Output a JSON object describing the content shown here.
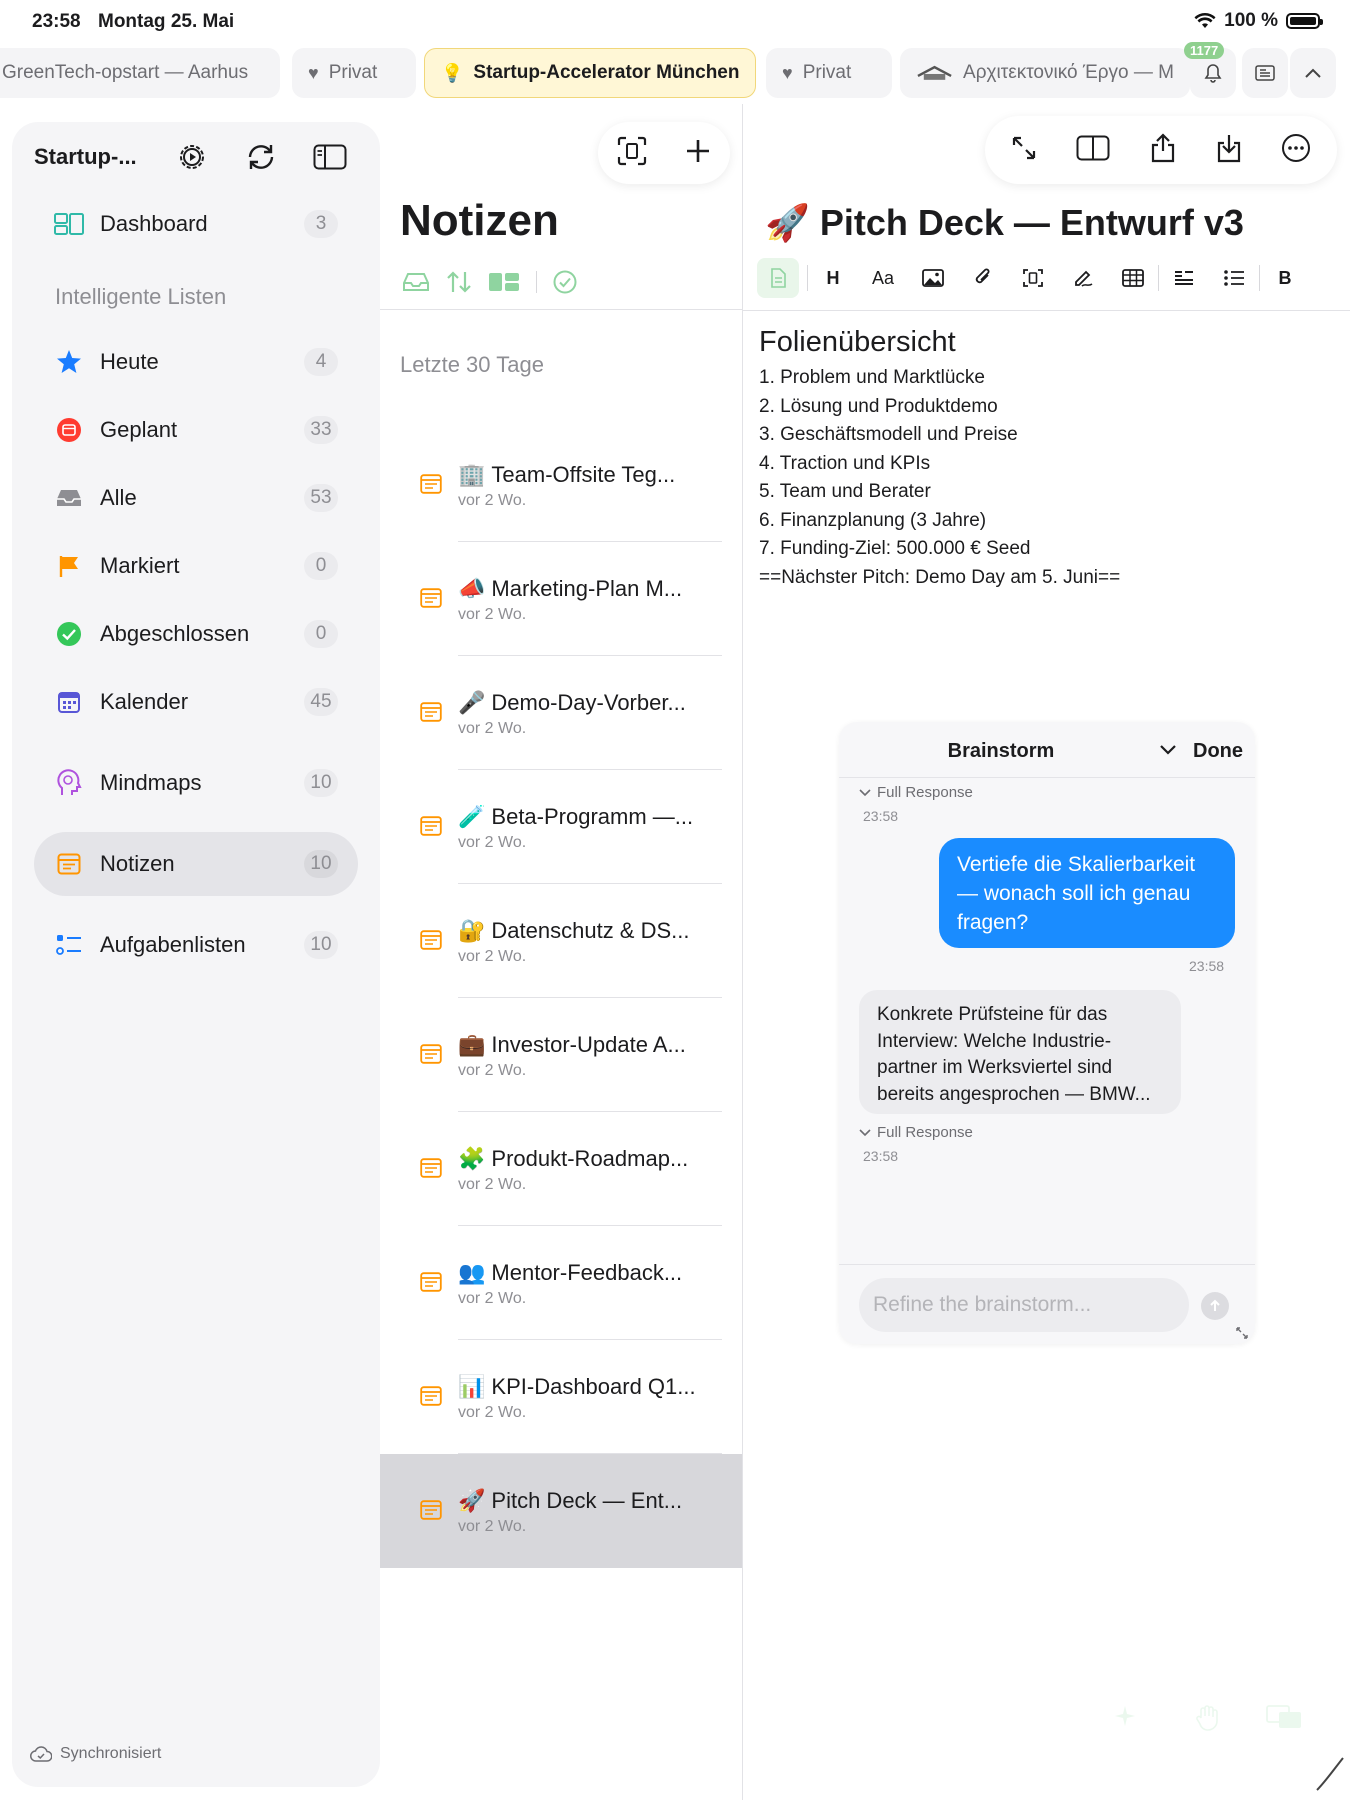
{
  "status_bar": {
    "time": "23:58",
    "date": "Montag 25. Mai",
    "battery": "100 %"
  },
  "tabs": [
    {
      "label": "GreenTech-opstart — Aarhus",
      "icon": "",
      "active": false
    },
    {
      "label": "Privat",
      "icon": "heart-icon",
      "active": false
    },
    {
      "label": "Startup-Accelerator München",
      "icon": "lightbulb-icon",
      "active": true
    },
    {
      "label": "Privat",
      "icon": "heart-icon",
      "active": false
    },
    {
      "label": "Αρχιτεκτονικό Έργο — M",
      "icon": "house-icon",
      "active": false
    }
  ],
  "tab_actions": {
    "notification_count": "1177"
  },
  "sidebar": {
    "title": "Startup-...",
    "section_label": "Intelligente Listen",
    "sync_status": "Synchronisiert",
    "items": [
      {
        "label": "Dashboard",
        "count": "3",
        "icon": "dashboard-icon",
        "color": "#2fb9a8"
      },
      {
        "label": "Heute",
        "count": "4",
        "icon": "star-icon",
        "color": "#1a7cff"
      },
      {
        "label": "Geplant",
        "count": "33",
        "icon": "calendar-red-icon",
        "color": "#ff3b30"
      },
      {
        "label": "Alle",
        "count": "53",
        "icon": "tray-icon",
        "color": "#8e8e93"
      },
      {
        "label": "Markiert",
        "count": "0",
        "icon": "flag-icon",
        "color": "#ff9500"
      },
      {
        "label": "Abgeschlossen",
        "count": "0",
        "icon": "check-circle-icon",
        "color": "#34c759"
      },
      {
        "label": "Kalender",
        "count": "45",
        "icon": "calendar-icon",
        "color": "#5856d6"
      },
      {
        "label": "Mindmaps",
        "count": "10",
        "icon": "brain-icon",
        "color": "#af52de"
      },
      {
        "label": "Notizen",
        "count": "10",
        "icon": "notes-icon",
        "color": "#ff9500"
      },
      {
        "label": "Aufgabenlisten",
        "count": "10",
        "icon": "checklist-icon",
        "color": "#1a7cff"
      }
    ]
  },
  "note_list": {
    "title": "Notizen",
    "section": "Letzte 30 Tage",
    "notes": [
      {
        "emoji": "🏢",
        "title": "Team-Offsite Teg...",
        "meta": "vor 2 Wo."
      },
      {
        "emoji": "📣",
        "title": "Marketing-Plan M...",
        "meta": "vor 2 Wo."
      },
      {
        "emoji": "🎤",
        "title": "Demo-Day-Vorber...",
        "meta": "vor 2 Wo."
      },
      {
        "emoji": "🧪",
        "title": "Beta-Programm —...",
        "meta": "vor 2 Wo."
      },
      {
        "emoji": "🔐",
        "title": "Datenschutz & DS...",
        "meta": "vor 2 Wo."
      },
      {
        "emoji": "💼",
        "title": "Investor-Update A...",
        "meta": "vor 2 Wo."
      },
      {
        "emoji": "🧩",
        "title": "Produkt-Roadmap...",
        "meta": "vor 2 Wo."
      },
      {
        "emoji": "👥",
        "title": "Mentor-Feedback...",
        "meta": "vor 2 Wo."
      },
      {
        "emoji": "📊",
        "title": "KPI-Dashboard Q1...",
        "meta": "vor 2 Wo."
      },
      {
        "emoji": "🚀",
        "title": "Pitch Deck — Ent...",
        "meta": "vor 2 Wo.",
        "selected": true
      }
    ]
  },
  "editor": {
    "title": "🚀 Pitch Deck — Entwurf v3",
    "heading": "Folienübersicht",
    "lines": [
      "1. Problem und Marktlücke",
      "2. Lösung und Produktdemo",
      "3. Geschäftsmodell und Preise",
      "4. Traction und KPIs",
      "5. Team und Berater",
      "6. Finanzplanung (3 Jahre)",
      "7. Funding-Ziel: 500.000 € Seed",
      "==Nächster Pitch: Demo Day am 5. Juni=="
    ],
    "format_labels": {
      "heading": "H",
      "font": "Aa",
      "bold": "B"
    }
  },
  "brainstorm": {
    "title": "Brainstorm",
    "done_label": "Done",
    "full_response_label": "Full Response",
    "time_1": "23:58",
    "user_message": "Vertiefe die Skalierbarkeit — wonach soll ich genau fragen?",
    "user_time": "23:58",
    "assistant_message": "Konkrete Prüfsteine für das Interview: Welche Industrie-partner im Werksviertel sind bereits angesprochen — BMW...",
    "time_2": "23:58",
    "input_placeholder": "Refine the brainstorm..."
  }
}
